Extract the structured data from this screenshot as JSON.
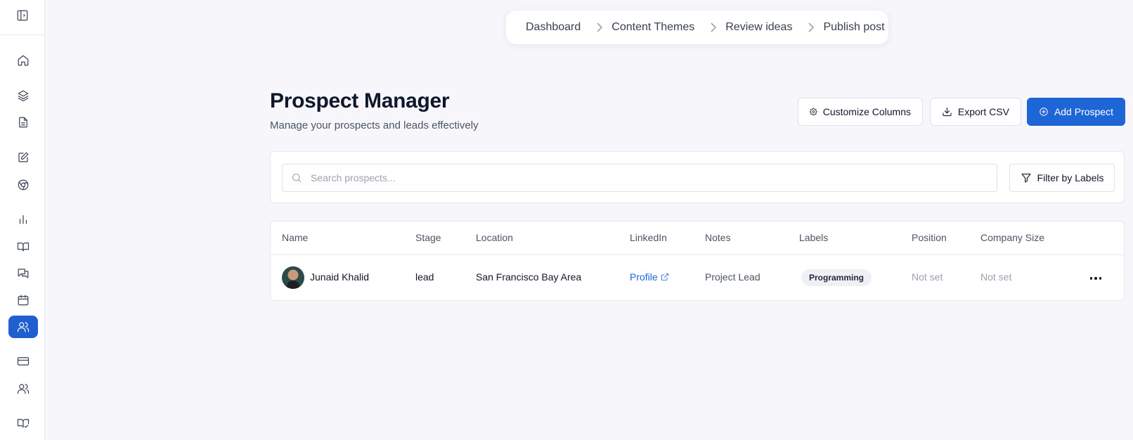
{
  "breadcrumb": [
    "Dashboard",
    "Content Themes",
    "Review ideas",
    "Publish post"
  ],
  "header": {
    "title": "Prospect Manager",
    "subtitle": "Manage your prospects and leads effectively"
  },
  "actions": {
    "customize_label": "Customize Columns",
    "export_label": "Export CSV",
    "add_label": "Add Prospect"
  },
  "search": {
    "placeholder": "Search prospects...",
    "value": "",
    "filter_label": "Filter by Labels"
  },
  "table": {
    "columns": [
      "Name",
      "Stage",
      "Location",
      "LinkedIn",
      "Notes",
      "Labels",
      "Position",
      "Company Size"
    ],
    "rows": [
      {
        "name": "Junaid Khalid",
        "stage": "lead",
        "location": "San Francisco Bay Area",
        "linkedin": "Profile",
        "notes": "Project Lead",
        "label": "Programming",
        "position": "Not set",
        "company_size": "Not set"
      }
    ]
  },
  "sidebar": {
    "items": [
      "sidebar-toggle-icon",
      "home-icon",
      "layers-icon",
      "document-icon",
      "edit-icon",
      "chrome-icon",
      "bar-chart-icon",
      "book-icon",
      "messages-icon",
      "calendar-icon",
      "users-icon",
      "credit-card-icon",
      "team-icon",
      "book-check-icon"
    ],
    "active": "users-icon"
  },
  "colors": {
    "primary": "#1e66d6",
    "active_sidebar": "#1f5fcf",
    "link": "#1e66d6",
    "background": "#f6f6fb"
  }
}
